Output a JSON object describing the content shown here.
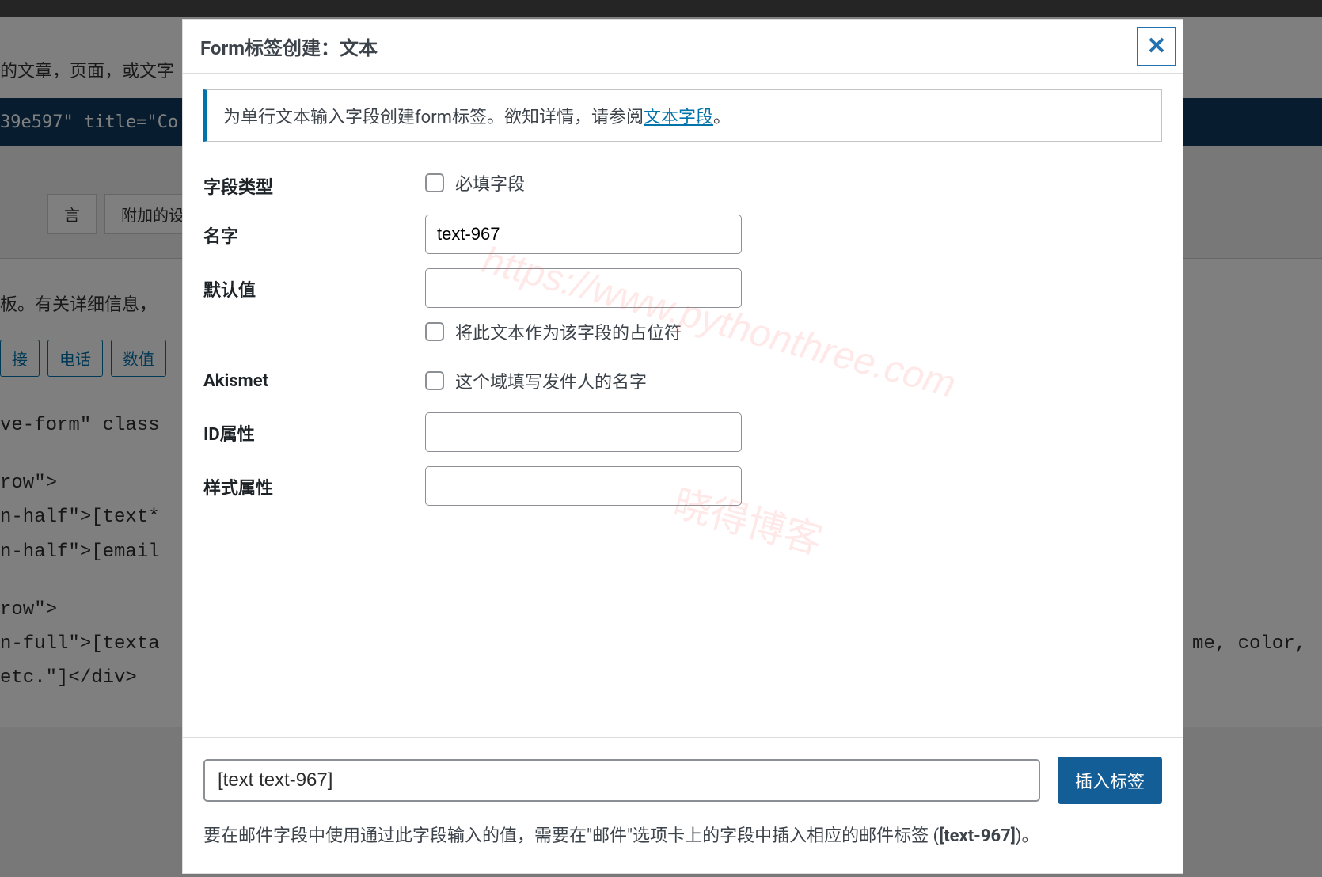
{
  "background": {
    "headerText": "的文章，页面，或文字",
    "shortcodeFragment": "39e597\" title=\"Co",
    "tabMessage": "言",
    "tabSettings": "附加的设置 (",
    "formDesc": "板。有关详细信息，",
    "btnLink": "接",
    "btnPhone": "电话",
    "btnNumber": "数值",
    "codeLine1": "ve-form\" class",
    "codeLine2": "row\">",
    "codeLine3": "n-half\">[text*",
    "codeLine4": "n-half\">[email",
    "codeLine5": "row\">",
    "codeLine6": "n-full\">[texta",
    "codeLine7": "etc.\"]</div>",
    "codeRight": "me, color,"
  },
  "modal": {
    "title": "Form标签创建：文本",
    "notice": {
      "prefix": "为单行文本输入字段创建form标签。欲知详情，请参阅",
      "link": "文本字段",
      "suffix": "。"
    },
    "fields": {
      "fieldType": {
        "label": "字段类型",
        "requiredLabel": "必填字段"
      },
      "name": {
        "label": "名字",
        "value": "text-967"
      },
      "defaultValue": {
        "label": "默认值",
        "value": "",
        "placeholderLabel": "将此文本作为该字段的占位符"
      },
      "akismet": {
        "label": "Akismet",
        "senderNameLabel": "这个域填写发件人的名字"
      },
      "idAttr": {
        "label": "ID属性",
        "value": ""
      },
      "classAttr": {
        "label": "样式属性",
        "value": ""
      }
    },
    "footer": {
      "shortcode": "[text text-967]",
      "insertBtn": "插入标签",
      "notePrefix": "要在邮件字段中使用通过此字段输入的值，需要在\"邮件\"选项卡上的字段中插入相应的邮件标签",
      "noteTag": "[text-967]",
      "noteSuffix": "。"
    }
  },
  "watermark": {
    "url": "https://www.pythonthree.com",
    "text": "晓得博客"
  }
}
